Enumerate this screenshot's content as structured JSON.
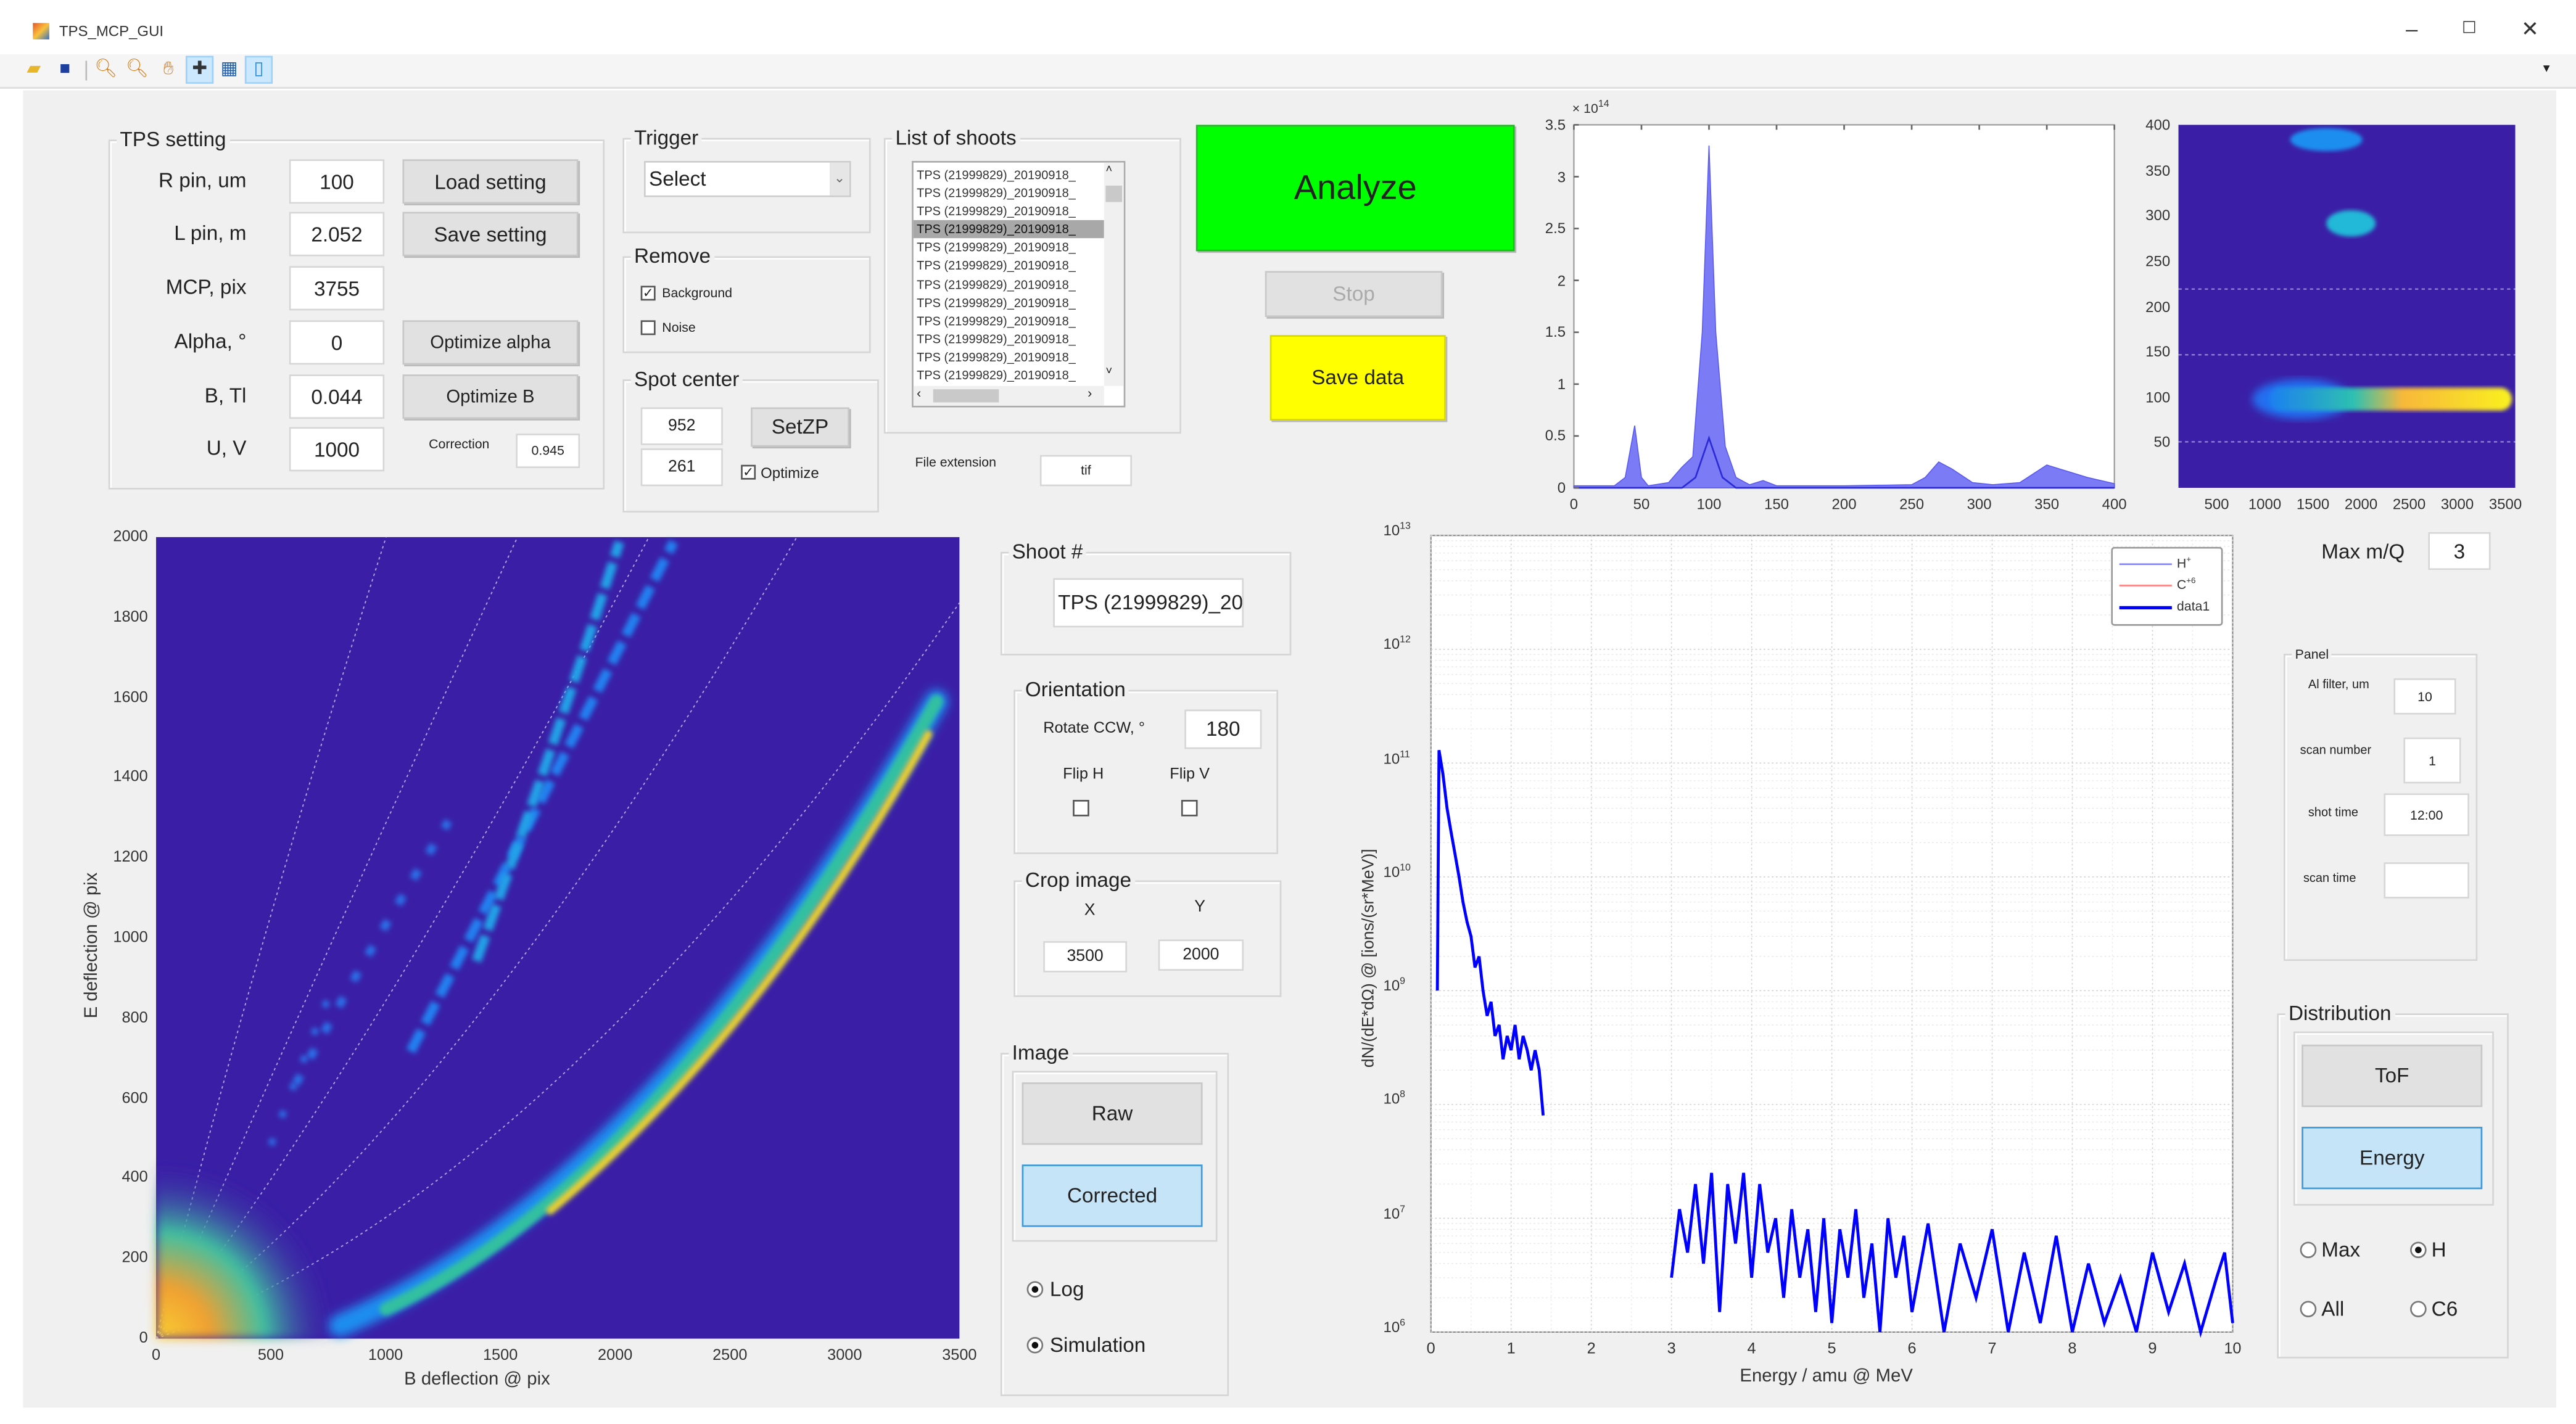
{
  "window": {
    "title": "TPS_MCP_GUI",
    "controls": [
      "–",
      "☐",
      "✕"
    ]
  },
  "toolbar": {
    "icons": [
      "open-file-icon",
      "save-icon",
      "zoom-in-icon",
      "zoom-out-icon",
      "pan-icon",
      "data-cursor-icon",
      "insert-colorbar-icon",
      "insert-legend-icon"
    ],
    "overflow": "▾"
  },
  "tps_setting": {
    "title": "TPS setting",
    "rows": [
      {
        "label": "R pin, um",
        "value": "100"
      },
      {
        "label": "L pin, m",
        "value": "2.052"
      },
      {
        "label": "MCP, pix",
        "value": "3755"
      },
      {
        "label": "Alpha, °",
        "value": "0"
      },
      {
        "label": "B, Tl",
        "value": "0.044"
      },
      {
        "label": "U, V",
        "value": "1000"
      }
    ],
    "buttons": {
      "load": "Load setting",
      "save": "Save setting",
      "opt_alpha": "Optimize alpha",
      "opt_b": "Optimize B"
    },
    "correction_label": "Correction",
    "correction_value": "0.945"
  },
  "trigger": {
    "title": "Trigger",
    "selected": "Select"
  },
  "remove": {
    "title": "Remove",
    "background_label": "Background",
    "background_checked": true,
    "noise_label": "Noise",
    "noise_checked": false
  },
  "spot_center": {
    "title": "Spot center",
    "x": "952",
    "y": "261",
    "setzp": "SetZP",
    "optimize_label": "Optimize",
    "optimize_checked": true
  },
  "shoots": {
    "title": "List of shoots",
    "items": [
      "TPS (21999829)_20190918_",
      "TPS (21999829)_20190918_",
      "TPS (21999829)_20190918_",
      "TPS (21999829)_20190918_",
      "TPS (21999829)_20190918_",
      "TPS (21999829)_20190918_",
      "TPS (21999829)_20190918_",
      "TPS (21999829)_20190918_",
      "TPS (21999829)_20190918_",
      "TPS (21999829)_20190918_",
      "TPS (21999829)_20190918_",
      "TPS (21999829)_20190918_"
    ],
    "selected_index": 3,
    "file_ext_label": "File extension",
    "file_ext_value": "tif"
  },
  "actions": {
    "analyze": "Analyze",
    "stop": "Stop",
    "save_data": "Save data",
    "analyze_color": "#00ff00",
    "save_color": "#ffff00"
  },
  "shoot_no": {
    "title": "Shoot  #",
    "value": "TPS (21999829)_20"
  },
  "orientation": {
    "title": "Orientation",
    "rotate_label": "Rotate CCW, °",
    "rotate_value": "180",
    "flip_h": "Flip H",
    "flip_v": "Flip V",
    "flip_h_checked": false,
    "flip_v_checked": false
  },
  "crop": {
    "title": "Crop image",
    "x_label": "X",
    "y_label": "Y",
    "x_value": "3500",
    "y_value": "2000"
  },
  "image_panel": {
    "title": "Image",
    "raw": "Raw",
    "corrected": "Corrected",
    "log": "Log",
    "simulation": "Simulation",
    "log_on": true,
    "simulation_on": true
  },
  "right": {
    "max_mq_label": "Max m/Q",
    "max_mq_value": "3",
    "panel_title": "Panel",
    "fields": [
      {
        "label": "Al filter, um",
        "value": "10"
      },
      {
        "label": "scan number",
        "value": "1"
      },
      {
        "label": "shot time",
        "value": "12:00"
      },
      {
        "label": "scan time",
        "value": ""
      }
    ],
    "distribution": {
      "title": "Distribution",
      "tof": "ToF",
      "energy": "Energy",
      "max": "Max",
      "h": "H",
      "all": "All",
      "c6": "C6",
      "selected": "H"
    }
  },
  "chart_data": [
    {
      "id": "histogram",
      "type": "area",
      "title": "",
      "xlabel": "",
      "ylabel": "",
      "exponent_label": "× 10",
      "exponent": "14",
      "xlim": [
        0,
        400
      ],
      "ylim": [
        0,
        3.5
      ],
      "xticks": [
        "0",
        "50",
        "100",
        "150",
        "200",
        "250",
        "300",
        "350",
        "400"
      ],
      "yticks": [
        "0",
        "0.5",
        "1",
        "1.5",
        "2",
        "2.5",
        "3",
        "3.5"
      ],
      "series": [
        {
          "name": "total",
          "x": [
            0,
            30,
            38,
            45,
            50,
            55,
            70,
            80,
            88,
            95,
            100,
            105,
            112,
            120,
            130,
            140,
            150,
            200,
            250,
            260,
            270,
            280,
            295,
            310,
            330,
            350,
            360,
            380,
            400
          ],
          "y": [
            0.02,
            0.02,
            0.1,
            0.6,
            0.1,
            0.02,
            0.05,
            0.2,
            0.3,
            1.5,
            3.3,
            1.5,
            0.4,
            0.1,
            0.03,
            0.07,
            0.02,
            0.02,
            0.03,
            0.1,
            0.25,
            0.18,
            0.05,
            0.03,
            0.05,
            0.22,
            0.18,
            0.1,
            0.04
          ]
        },
        {
          "name": "component",
          "x": [
            0,
            80,
            90,
            100,
            110,
            120,
            400
          ],
          "y": [
            0,
            0,
            0.1,
            0.48,
            0.1,
            0,
            0
          ]
        }
      ]
    },
    {
      "id": "mq-image",
      "type": "heatmap",
      "xlim": [
        0,
        3500
      ],
      "ylim": [
        0,
        400
      ],
      "xticks": [
        "500",
        "1000",
        "1500",
        "2000",
        "2500",
        "3000",
        "3500"
      ],
      "yticks": [
        "50",
        "100",
        "150",
        "200",
        "250",
        "300",
        "350",
        "400"
      ]
    },
    {
      "id": "tps-image",
      "type": "heatmap",
      "xlabel": "B deflection @ pix",
      "ylabel": "E deflection @ pix",
      "xlim": [
        0,
        3500
      ],
      "ylim": [
        0,
        2000
      ],
      "xticks": [
        "0",
        "500",
        "1000",
        "1500",
        "2000",
        "2500",
        "3000",
        "3500"
      ],
      "yticks": [
        "0",
        "200",
        "400",
        "600",
        "800",
        "1000",
        "1200",
        "1400",
        "1600",
        "1800",
        "2000"
      ]
    },
    {
      "id": "energy-spectrum",
      "type": "line",
      "xlabel": "Energy / amu @ MeV",
      "ylabel": "dN/(dE*dΩ) @ [ions/(sr*MeV)]",
      "xlim": [
        0,
        10
      ],
      "ylim": [
        1000000.0,
        10000000000000.0
      ],
      "yscale": "log",
      "grid": true,
      "legend_position": "top-right",
      "xticks": [
        "0",
        "1",
        "2",
        "3",
        "4",
        "5",
        "6",
        "7",
        "8",
        "9",
        "10"
      ],
      "ytick_exponents": [
        "6",
        "7",
        "8",
        "9",
        "10",
        "11",
        "12",
        "13"
      ],
      "legend": [
        {
          "label": "H",
          "sup": "+",
          "color": "#8080ff"
        },
        {
          "label": "C",
          "sup": "+6",
          "color": "#ff8080"
        },
        {
          "label": "data1",
          "sup": "",
          "color": "#0000ff"
        }
      ],
      "series": [
        {
          "name": "data1",
          "segment": 1,
          "x": [
            0.08,
            0.1,
            0.15,
            0.2,
            0.25,
            0.3,
            0.35,
            0.4,
            0.45,
            0.5,
            0.55,
            0.6,
            0.65,
            0.7,
            0.75,
            0.8,
            0.85,
            0.9,
            0.95,
            1.0,
            1.05,
            1.1,
            1.15,
            1.2,
            1.25,
            1.3,
            1.35,
            1.4
          ],
          "y": [
            1000000000.0,
            130000000000.0,
            80000000000.0,
            40000000000.0,
            25000000000.0,
            16000000000.0,
            10000000000.0,
            6000000000.0,
            4000000000.0,
            3000000000.0,
            1600000000.0,
            2000000000.0,
            1000000000.0,
            600000000.0,
            800000000.0,
            400000000.0,
            500000000.0,
            250000000.0,
            400000000.0,
            300000000.0,
            500000000.0,
            250000000.0,
            400000000.0,
            300000000.0,
            200000000.0,
            300000000.0,
            200000000.0,
            80000000.0
          ]
        },
        {
          "name": "data1",
          "segment": 2,
          "x": [
            3.0,
            3.1,
            3.2,
            3.3,
            3.4,
            3.5,
            3.6,
            3.7,
            3.8,
            3.9,
            4.0,
            4.1,
            4.2,
            4.3,
            4.4,
            4.5,
            4.6,
            4.7,
            4.8,
            4.9,
            5.0,
            5.1,
            5.2,
            5.3,
            5.4,
            5.5,
            5.6,
            5.7,
            5.8,
            5.9,
            6.0,
            6.2,
            6.4,
            6.6,
            6.8,
            7.0,
            7.2,
            7.4,
            7.6,
            7.8,
            8.0,
            8.2,
            8.4,
            8.6,
            8.8,
            9.0,
            9.2,
            9.4,
            9.6,
            9.8,
            9.9,
            10.0
          ],
          "y": [
            3000000.0,
            12000000.0,
            5000000.0,
            20000000.0,
            4000000.0,
            25000000.0,
            1500000.0,
            20000000.0,
            6000000.0,
            25000000.0,
            3000000.0,
            20000000.0,
            5000000.0,
            10000000.0,
            2000000.0,
            12000000.0,
            3000000.0,
            8000000.0,
            1500000.0,
            10000000.0,
            1200000.0,
            8000000.0,
            3000000.0,
            12000000.0,
            2000000.0,
            6000000.0,
            1000000.0,
            10000000.0,
            3000000.0,
            7000000.0,
            1500000.0,
            9000000.0,
            1000000.0,
            6000000.0,
            2000000.0,
            8000000.0,
            1000000.0,
            5000000.0,
            1200000.0,
            7000000.0,
            1000000.0,
            4000000.0,
            1200000.0,
            3000000.0,
            1000000.0,
            5000000.0,
            1500000.0,
            4000000.0,
            1000000.0,
            3000000.0,
            5000000.0,
            1200000.0
          ]
        }
      ]
    }
  ]
}
